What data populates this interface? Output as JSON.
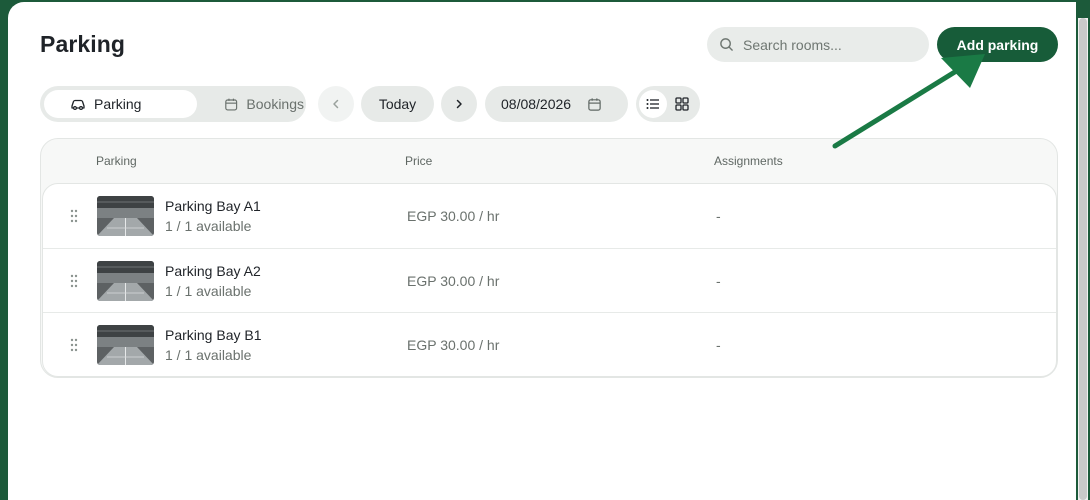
{
  "page": {
    "title": "Parking"
  },
  "search": {
    "placeholder": "Search rooms..."
  },
  "actions": {
    "add_label": "Add parking"
  },
  "tabs": [
    {
      "label": "Parking",
      "icon": "car-icon",
      "active": true
    },
    {
      "label": "Bookings",
      "icon": "calendar-icon",
      "active": false
    }
  ],
  "date_nav": {
    "today_label": "Today",
    "date_value": "08/08/2026"
  },
  "view_modes": [
    "list",
    "grid"
  ],
  "table": {
    "headers": {
      "name": "Parking",
      "price": "Price",
      "assignments": "Assignments"
    },
    "rows": [
      {
        "name": "Parking Bay A1",
        "availability": "1 / 1 available",
        "price": "EGP 30.00 / hr",
        "assignments": "-"
      },
      {
        "name": "Parking Bay A2",
        "availability": "1 / 1 available",
        "price": "EGP 30.00 / hr",
        "assignments": "-"
      },
      {
        "name": "Parking Bay B1",
        "availability": "1 / 1 available",
        "price": "EGP 30.00 / hr",
        "assignments": "-"
      }
    ]
  },
  "colors": {
    "brand": "#175c39",
    "frame": "#1c5a3a",
    "arrow": "#1a7a45"
  }
}
